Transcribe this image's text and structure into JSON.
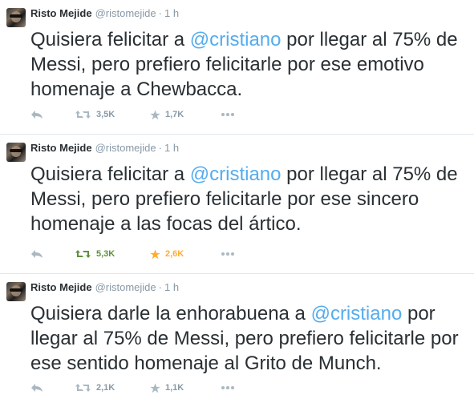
{
  "tweets": [
    {
      "name": "Risto Mejide",
      "handle": "@ristomejide",
      "dot": "·",
      "time": "1 h",
      "text_before": "Quisiera felicitar a ",
      "mention": "@cristiano",
      "text_after": " por llegar al 75% de Messi, pero prefiero felicitarle por ese emotivo homenaje a Chewbacca.",
      "retweets": "3,5K",
      "favorites": "1,7K",
      "retweeted": false,
      "favorited": false
    },
    {
      "name": "Risto Mejide",
      "handle": "@ristomejide",
      "dot": "·",
      "time": "1 h",
      "text_before": "Quisiera felicitar a ",
      "mention": "@cristiano",
      "text_after": " por llegar al 75% de Messi, pero prefiero felicitarle por ese sincero homenaje a las focas del ártico.",
      "retweets": "5,3K",
      "favorites": "2,6K",
      "retweeted": true,
      "favorited": true
    },
    {
      "name": "Risto Mejide",
      "handle": "@ristomejide",
      "dot": "·",
      "time": "1 h",
      "text_before": "Quisiera darle la enhorabuena a ",
      "mention": "@cristiano",
      "text_after": " por llegar al 75% de Messi, pero prefiero felicitarle por ese sentido homenaje al Grito de Munch.",
      "retweets": "2,1K",
      "favorites": "1,1K",
      "retweeted": false,
      "favorited": false
    }
  ],
  "colors": {
    "mention": "#55acee",
    "muted": "#8899a6",
    "retweet_active": "#5c913b",
    "favorite_active": "#ffac33",
    "divider": "#e1e8ed"
  },
  "icons": [
    "reply-icon",
    "retweet-icon",
    "favorite-icon",
    "more-icon"
  ]
}
